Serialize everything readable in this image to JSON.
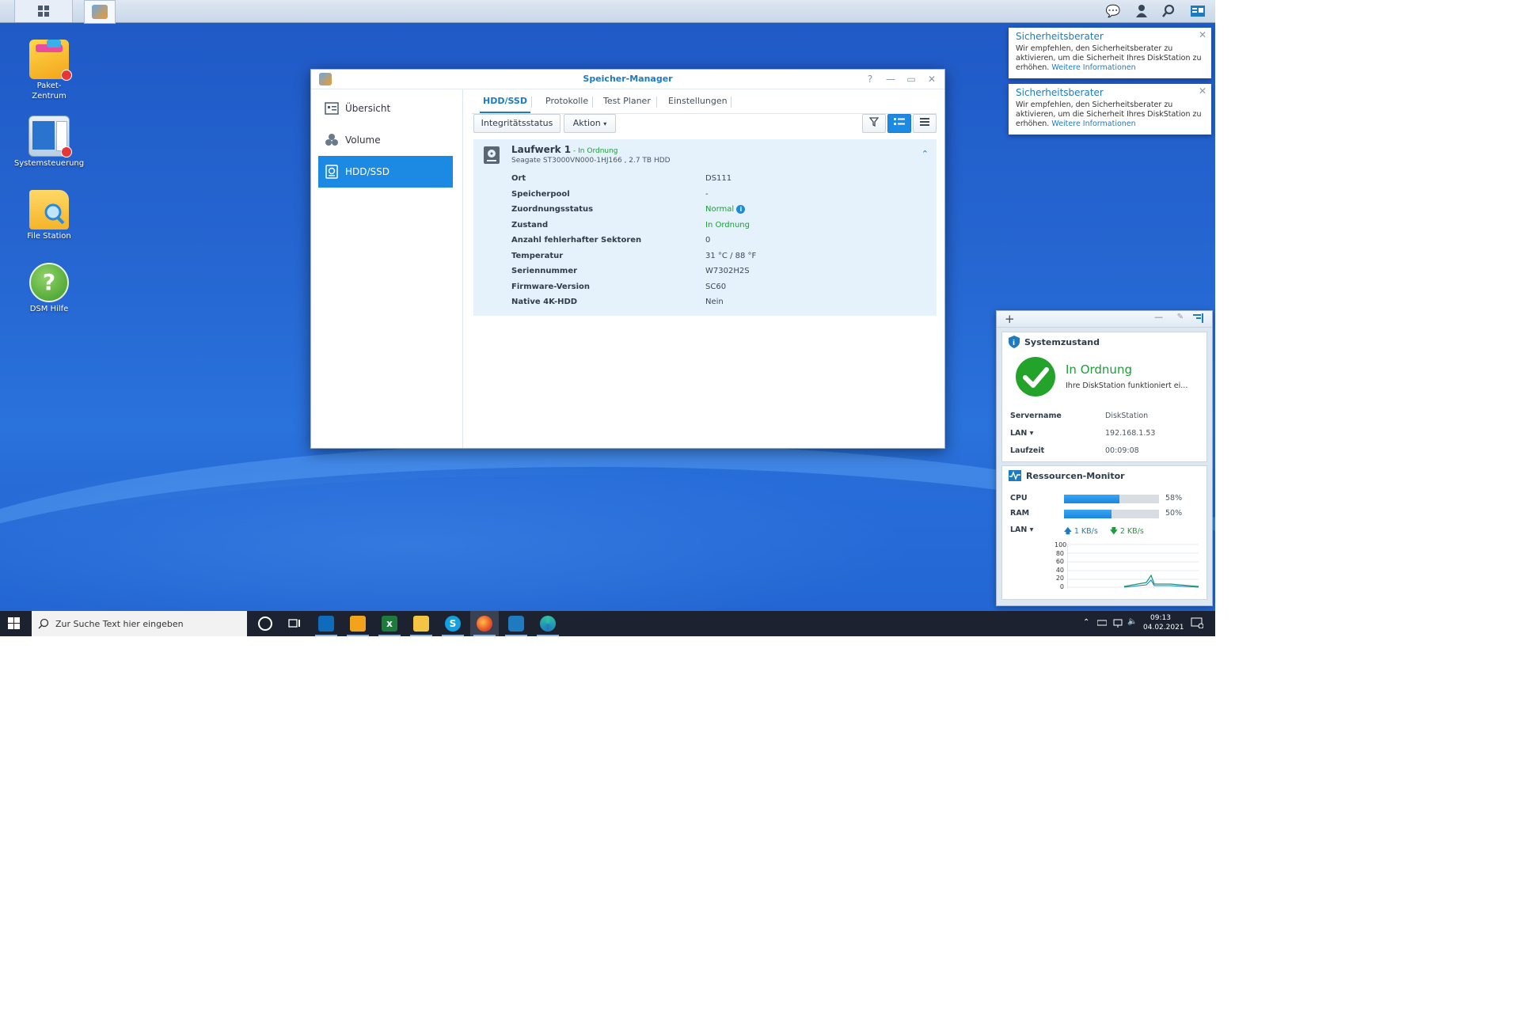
{
  "desktop": {
    "icons": [
      {
        "label": "Paket-\nZentrum"
      },
      {
        "label": "Systemsteuerung"
      },
      {
        "label": "File Station"
      },
      {
        "label": "DSM Hilfe"
      }
    ]
  },
  "window": {
    "title": "Speicher-Manager",
    "sidebar": [
      "Übersicht",
      "Volume",
      "HDD/SSD"
    ],
    "tabs": [
      "HDD/SSD",
      "Protokolle",
      "Test Planer",
      "Einstellungen"
    ],
    "toolbar": {
      "integrity": "Integritätsstatus",
      "action": "Aktion"
    },
    "drive": {
      "name": "Laufwerk 1",
      "status": " - In Ordnung",
      "model": "Seagate ST3000VN000-1HJ166 , 2.7 TB HDD",
      "properties": [
        {
          "key": "Ort",
          "value": "DS111"
        },
        {
          "key": "Speicherpool",
          "value": "-"
        },
        {
          "key": "Zuordnungsstatus",
          "value": "Normal"
        },
        {
          "key": "Zustand",
          "value": "In Ordnung"
        },
        {
          "key": "Anzahl fehlerhafter Sektoren",
          "value": "0"
        },
        {
          "key": "Temperatur",
          "value": "31 °C / 88 °F"
        },
        {
          "key": "Seriennummer",
          "value": "W7302H2S"
        },
        {
          "key": "Firmware-Version",
          "value": "SC60"
        },
        {
          "key": "Native 4K-HDD",
          "value": "Nein"
        }
      ]
    }
  },
  "notifications": [
    {
      "title": "Sicherheitsberater",
      "body": "Wir empfehlen, den Sicherheitsberater zu aktivieren, um die Sicherheit Ihres DiskStation zu erhöhen.",
      "link": "Weitere Informationen"
    },
    {
      "title": "Sicherheitsberater",
      "body": "Wir empfehlen, den Sicherheitsberater zu aktivieren, um die Sicherheit Ihres DiskStation zu erhöhen.",
      "link": "Weitere Informationen"
    }
  ],
  "widgets": {
    "health": {
      "title": "Systemzustand",
      "status": "In Ordnung",
      "desc": "Ihre DiskStation funktioniert ei...",
      "rows": [
        {
          "key": "Servername",
          "value": "DiskStation"
        },
        {
          "key": "LAN ▾",
          "value": "192.168.1.53"
        },
        {
          "key": "Laufzeit",
          "value": "00:09:08"
        }
      ]
    },
    "resource": {
      "title": "Ressourcen-Monitor",
      "cpu_label": "CPU",
      "cpu_value": "58%",
      "cpu_fraction": 0.58,
      "ram_label": "RAM",
      "ram_value": "50%",
      "ram_fraction": 0.5,
      "lan_label": "LAN ▾",
      "upload": "1 KB/s",
      "download": "2 KB/s",
      "chart_ticks": [
        "100",
        "80",
        "60",
        "40",
        "20",
        "0"
      ]
    }
  },
  "taskbar": {
    "search_placeholder": "Zur Suche Text hier eingeben",
    "time": "09:13",
    "date": "04.02.2021"
  }
}
